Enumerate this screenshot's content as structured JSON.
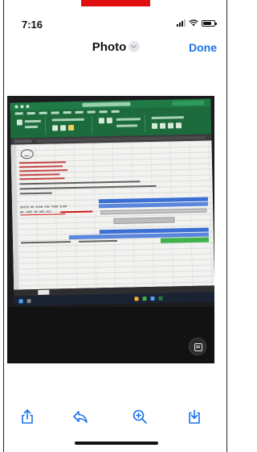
{
  "status_bar": {
    "time": "7:16",
    "battery_level": 0.75
  },
  "nav": {
    "title": "Photo",
    "done_label": "Done"
  },
  "photo_content": {
    "sheet_lines": [
      "ENTER OR SCAN VIN THEN SCAN",
      "QR CODE ON ABS HCU"
    ]
  },
  "toolbar": {
    "items": [
      "share-icon",
      "revert-icon",
      "zoom-icon",
      "download-icon"
    ]
  },
  "colors": {
    "accent": "#1a73e8",
    "excel_green": "#1d6b3d",
    "cell_blue": "#3b6fd4",
    "cell_green": "#3fb34a",
    "red_tab": "#e01010"
  }
}
